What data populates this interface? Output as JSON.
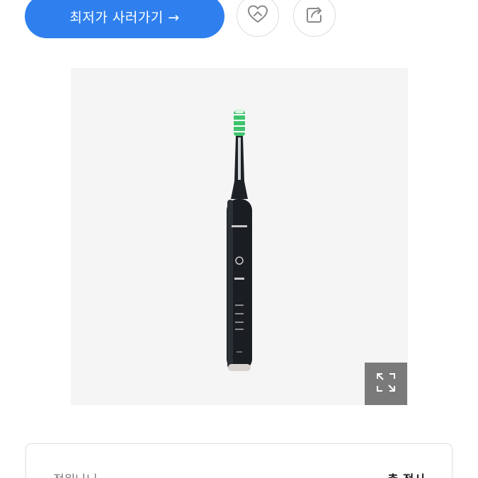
{
  "header": {
    "cta_label": "최저가 사러가기 →"
  },
  "icons": {
    "like": "heart-icon",
    "share": "share-icon",
    "expand": "expand-icon"
  },
  "product": {
    "image_alt": "electric-toothbrush"
  },
  "info_card": {
    "left_label": "정원나니",
    "right_label": "총 정시"
  },
  "colors": {
    "accent": "#2f80ee",
    "image_bg": "#f5f5f5",
    "expand_bg": "#7a7a7a"
  }
}
